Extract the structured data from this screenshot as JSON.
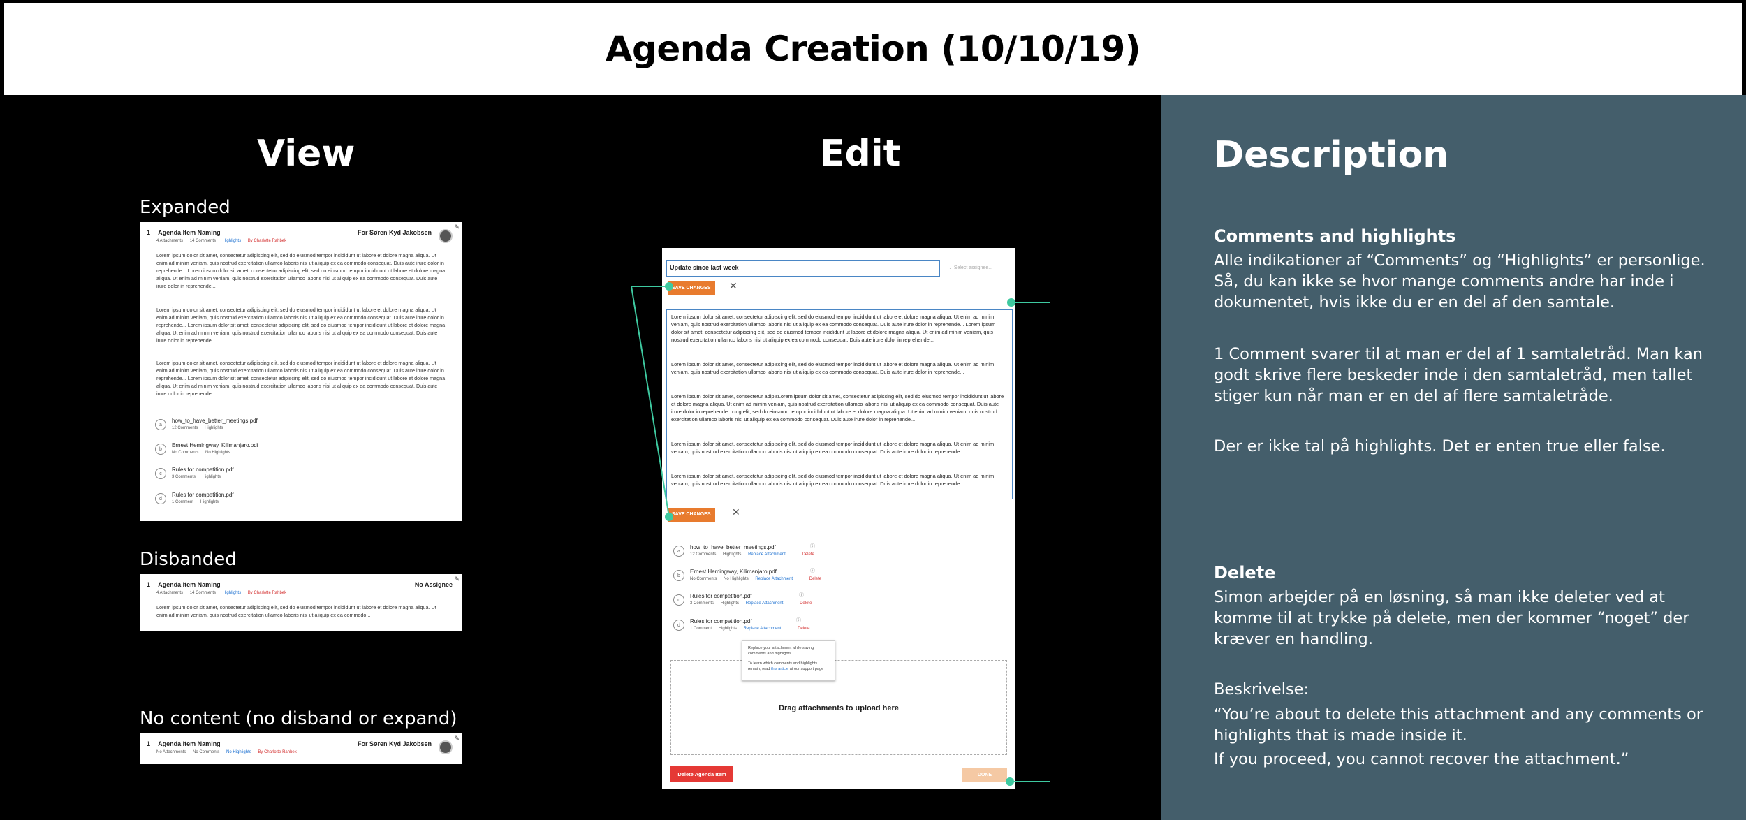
{
  "page": {
    "title": "Agenda Creation (10/10/19)"
  },
  "columns": {
    "view": "View",
    "edit": "Edit",
    "description": "Description"
  },
  "view": {
    "expanded": {
      "label": "Expanded",
      "item_number": "1",
      "item_title": "Agenda Item Naming",
      "attachments": "4 Attachments",
      "comments": "14 Comments",
      "highlights": "Highlights",
      "by": "By Charlotte Rahbek",
      "assignee": "For Søren Kyd Jakobsen",
      "paragraphs": [
        "Lorem ipsum dolor sit amet, consectetur adipiscing elit, sed do eiusmod tempor incididunt ut labore et dolore magna aliqua. Ut enim ad minim veniam, quis nostrud exercitation ullamco laboris nisi ut aliquip ex ea commodo consequat. Duis aute irure dolor in reprehende... Lorem ipsum dolor sit amet, consectetur adipiscing elit, sed do eiusmod tempor incididunt ut labore et dolore magna aliqua. Ut enim ad minim veniam, quis nostrud exercitation ullamco laboris nisi ut aliquip ex ea commodo consequat. Duis aute irure dolor in reprehende...",
        "Lorem ipsum dolor sit amet, consectetur adipiscing elit, sed do eiusmod tempor incididunt ut labore et dolore magna aliqua. Ut enim ad minim veniam, quis nostrud exercitation ullamco laboris nisi ut aliquip ex ea commodo consequat. Duis aute irure dolor in reprehende... Lorem ipsum dolor sit amet, consectetur adipiscing elit, sed do eiusmod tempor incididunt ut labore et dolore magna aliqua. Ut enim ad minim veniam, quis nostrud exercitation ullamco laboris nisi ut aliquip ex ea commodo consequat. Duis aute irure dolor in reprehende...",
        "Lorem ipsum dolor sit amet, consectetur adipiscing elit, sed do eiusmod tempor incididunt ut labore et dolore magna aliqua. Ut enim ad minim veniam, quis nostrud exercitation ullamco laboris nisi ut aliquip ex ea commodo consequat. Duis aute irure dolor in reprehende... Lorem ipsum dolor sit amet, consectetur adipiscing elit, sed do eiusmod tempor incididunt ut labore et dolore magna aliqua. Ut enim ad minim veniam, quis nostrud exercitation ullamco laboris nisi ut aliquip ex ea commodo consequat. Duis aute irure dolor in reprehende..."
      ],
      "attachment_items": [
        {
          "letter": "a",
          "name": "how_to_have_better_meetings.pdf",
          "comments": "12 Comments",
          "highlights": "Highlights"
        },
        {
          "letter": "b",
          "name": "Ernest Hemingway, Kilimanjaro.pdf",
          "comments": "No Comments",
          "highlights": "No Highlights"
        },
        {
          "letter": "c",
          "name": "Rules for competition.pdf",
          "comments": "3 Comments",
          "highlights": "Highlights"
        },
        {
          "letter": "d",
          "name": "Rules for competition.pdf",
          "comments": "1 Comment",
          "highlights": "Highlights"
        }
      ]
    },
    "disbanded": {
      "label": "Disbanded",
      "item_number": "1",
      "item_title": "Agenda Item Naming",
      "attachments": "4 Attachments",
      "comments": "14 Comments",
      "highlights": "Highlights",
      "by": "By Charlotte Rahbek",
      "assignee": "No Assignee",
      "paragraph": "Lorem ipsum dolor sit amet, consectetur adipiscing elit, sed do eiusmod tempor incididunt ut labore et dolore magna aliqua. Ut enim ad minim veniam, quis nostrud exercitation ullamco laboris nisi ut aliquip ex ea commodo..."
    },
    "no_content": {
      "label": "No content (no disband or expand)",
      "item_number": "1",
      "item_title": "Agenda Item Naming",
      "attachments": "No Attachments",
      "comments": "No Comments",
      "highlights": "No Highlights",
      "by": "By Charlotte Rahbek",
      "assignee": "For Søren Kyd Jakobsen"
    }
  },
  "edit": {
    "title_value": "Update since last week",
    "assignee_placeholder": "Select assignee...",
    "save_changes": "SAVE CHANGES",
    "paragraphs": [
      "Lorem ipsum dolor sit amet, consectetur adipiscing elit, sed do eiusmod tempor incididunt ut labore et dolore magna aliqua. Ut enim ad minim veniam, quis nostrud exercitation ullamco laboris nisi ut aliquip ex ea commodo consequat. Duis aute irure dolor in reprehende... Lorem ipsum dolor sit amet, consectetur adipiscing elit, sed do eiusmod tempor incididunt ut labore et dolore magna aliqua. Ut enim ad minim veniam, quis nostrud exercitation ullamco laboris nisi ut aliquip ex ea commodo consequat. Duis aute irure dolor in reprehende...",
      "Lorem ipsum dolor sit amet, consectetur adipiscing elit, sed do eiusmod tempor incididunt ut labore et dolore magna aliqua. Ut enim ad minim veniam, quis nostrud exercitation ullamco laboris nisi ut aliquip ex ea commodo consequat. Duis aute irure dolor in reprehende...",
      "Lorem ipsum dolor sit amet, consectetur adipisLorem ipsum dolor sit amet, consectetur adipiscing elit, sed do eiusmod tempor incididunt ut labore et dolore magna aliqua. Ut enim ad minim veniam, quis nostrud exercitation ullamco laboris nisi ut aliquip ex ea commodo consequat. Duis aute irure dolor in reprehende...cing elit, sed do eiusmod tempor incididunt ut labore et dolore magna aliqua. Ut enim ad minim veniam, quis nostrud exercitation ullamco laboris nisi ut aliquip ex ea commodo consequat. Duis aute irure dolor in reprehende...",
      "Lorem ipsum dolor sit amet, consectetur adipiscing elit, sed do eiusmod tempor incididunt ut labore et dolore magna aliqua. Ut enim ad minim veniam, quis nostrud exercitation ullamco laboris nisi ut aliquip ex ea commodo consequat. Duis aute irure dolor in reprehende...",
      "Lorem ipsum dolor sit amet, consectetur adipiscing elit, sed do eiusmod tempor incididunt ut labore et dolore magna aliqua. Ut enim ad minim veniam, quis nostrud exercitation ullamco laboris nisi ut aliquip ex ea commodo consequat. Duis aute irure dolor in reprehende..."
    ],
    "attachment_items": [
      {
        "letter": "a",
        "name": "how_to_have_better_meetings.pdf",
        "comments": "12 Comments",
        "highlights": "Highlights",
        "replace": "Replace Attachment",
        "delete": "Delete"
      },
      {
        "letter": "b",
        "name": "Ernest Hemingway, Kilimanjaro.pdf",
        "comments": "No Comments",
        "highlights": "No Highlights",
        "replace": "Replace Attachment",
        "delete": "Delete"
      },
      {
        "letter": "c",
        "name": "Rules for competition.pdf",
        "comments": "3 Comments",
        "highlights": "Highlights",
        "replace": "Replace Attachment",
        "delete": "Delete"
      },
      {
        "letter": "d",
        "name": "Rules for competition.pdf",
        "comments": "1 Comment",
        "highlights": "Highlights",
        "replace": "Replace Attachment",
        "delete": "Delete"
      }
    ],
    "tooltip": {
      "line1": "Replace your attachment while saving comments and highlights.",
      "line2_pre": "To learn which comments and highlights remain, read",
      "line2_link": "this article",
      "line2_post": "at our support page"
    },
    "dropzone": "Drag attachments to upload here",
    "delete_item": "Delete Agenda Item",
    "done": "DONE"
  },
  "description": {
    "comments_heading": "Comments and highlights",
    "comments_p1": "Alle indikationer af “Comments” og “Highlights” er personlige. Så, du kan ikke se hvor mange comments andre har inde i dokumentet, hvis ikke du er en del af den samtale.",
    "comments_p2": "1 Comment svarer til at man er del af 1 samtaletråd. Man kan godt skrive flere beskeder inde i den samtaletråd, men tallet stiger kun når man er en del af flere samtaletråde.",
    "comments_p3": "Der er ikke tal på highlights. Det er enten true eller false.",
    "delete_heading": "Delete",
    "delete_p1": "Simon arbejder på en løsning, så man ikke deleter ved at komme til at trykke på delete, men der kommer “noget” der kræver en handling.",
    "delete_label": "Beskrivelse:",
    "delete_quote1": "“You’re about to delete this attachment and any comments or highlights that is made inside it.",
    "delete_quote2": "If you proceed, you cannot recover the attachment.”"
  },
  "colors": {
    "accent_orange": "#e87b2e",
    "link_blue": "#1a6fd0",
    "danger_red": "#e53935",
    "connector_green": "#3ec9a0",
    "description_bg": "#445e6b"
  }
}
